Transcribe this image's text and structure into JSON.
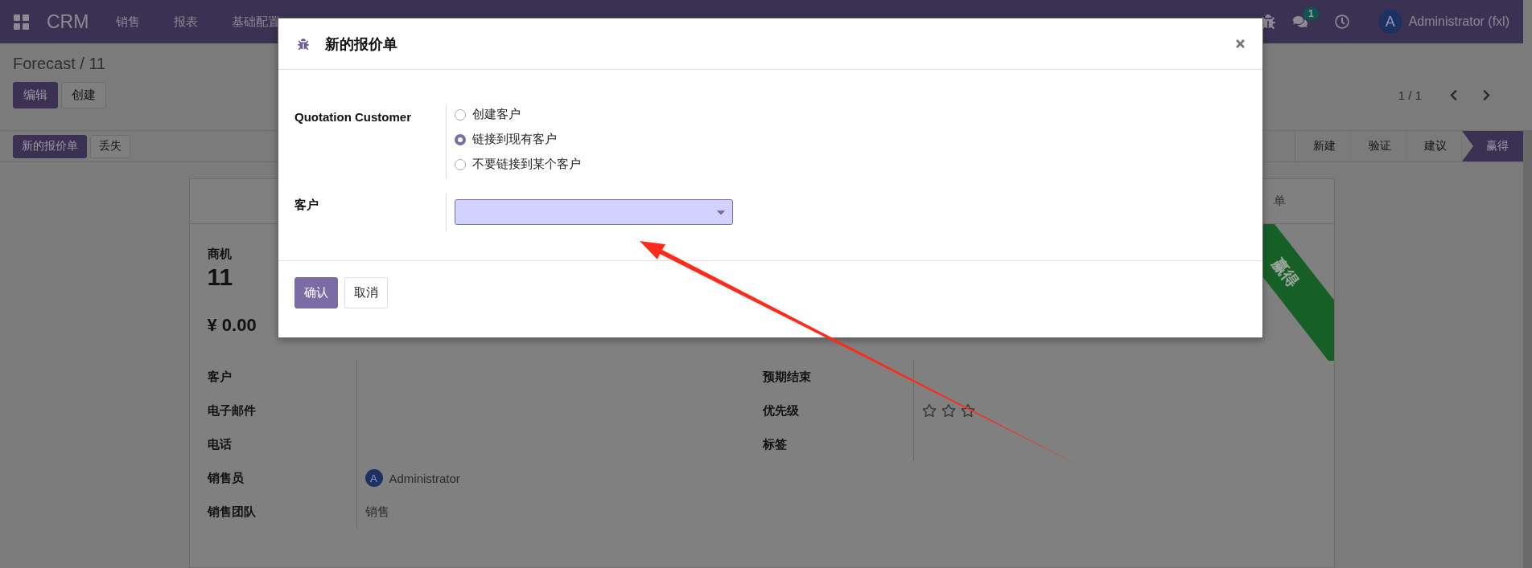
{
  "navbar": {
    "app_name": "CRM",
    "menu": [
      "销售",
      "报表",
      "基础配置"
    ],
    "notification_count": "1",
    "user": {
      "initial": "A",
      "name": "Administrator (fxl)"
    }
  },
  "breadcrumb": "Forecast / 11",
  "actions": [
    {
      "label": "编辑",
      "kind": "primary"
    },
    {
      "label": "创建",
      "kind": "secondary"
    }
  ],
  "pager": "1 / 1",
  "header_buttons": [
    {
      "label": "新的报价单",
      "kind": "primary"
    },
    {
      "label": "丢失",
      "kind": "secondary"
    }
  ],
  "stages": [
    {
      "label": "新建",
      "selected": false
    },
    {
      "label": "验证",
      "selected": false
    },
    {
      "label": "建议",
      "selected": false
    },
    {
      "label": "赢得",
      "selected": true
    }
  ],
  "record": {
    "header_tab": "单",
    "ribbon": "赢得",
    "opportunity_label": "商机",
    "name": "11",
    "revenue": "¥ 0.00",
    "left_fields": [
      {
        "label": "客户"
      },
      {
        "label": "电子邮件"
      },
      {
        "label": "电话"
      },
      {
        "label": "销售员",
        "value": "Administrator",
        "avatar": "A"
      },
      {
        "label": "销售团队",
        "value": "销售"
      }
    ],
    "right_fields": [
      {
        "label": "预期结束"
      },
      {
        "label": "优先级",
        "stars": 0
      },
      {
        "label": "标签"
      }
    ]
  },
  "dialog": {
    "title": "新的报价单",
    "fields": [
      {
        "label": "Quotation Customer",
        "kind": "radio",
        "options": [
          {
            "label": "创建客户",
            "selected": false
          },
          {
            "label": "链接到现有客户",
            "selected": true
          },
          {
            "label": "不要链接到某个客户",
            "selected": false
          }
        ]
      },
      {
        "label": "客户",
        "kind": "select"
      }
    ],
    "buttons": [
      {
        "label": "确认",
        "kind": "primary"
      },
      {
        "label": "取消",
        "kind": "secondary"
      }
    ]
  }
}
